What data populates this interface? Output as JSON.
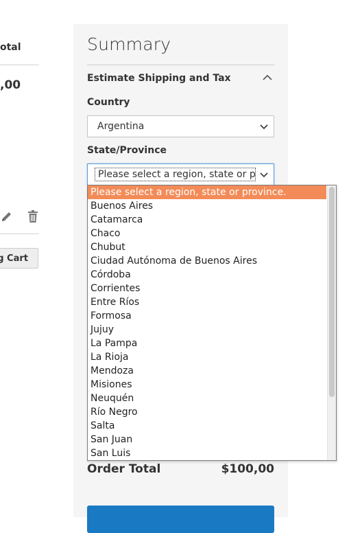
{
  "cart": {
    "subtotal_header": "otal",
    "price": ",00",
    "update_label": "g Cart"
  },
  "summary": {
    "title": "Summary",
    "estimate_title": "Estimate Shipping and Tax",
    "country_label": "Country",
    "country_value": "Argentina",
    "state_label": "State/Province",
    "state_value": "Please select a region, state or pro",
    "order_total_label": "Order Total",
    "order_total_value": "$100,00"
  },
  "dropdown": {
    "options": [
      "Please select a region, state or province.",
      "Buenos Aires",
      "Catamarca",
      "Chaco",
      "Chubut",
      "Ciudad Autónoma de Buenos Aires",
      "Córdoba",
      "Corrientes",
      "Entre Ríos",
      "Formosa",
      "Jujuy",
      "La Pampa",
      "La Rioja",
      "Mendoza",
      "Misiones",
      "Neuquén",
      "Río Negro",
      "Salta",
      "San Juan",
      "San Luis"
    ],
    "selected_index": 0
  },
  "colors": {
    "selected_option_bg": "#f38b58",
    "checkout_button": "#1979c3",
    "panel_bg": "#f5f5f5"
  },
  "icons": {
    "edit": "pencil-icon",
    "delete": "trash-icon",
    "collapse": "chevron-up-icon",
    "select": "chevron-down-icon"
  }
}
